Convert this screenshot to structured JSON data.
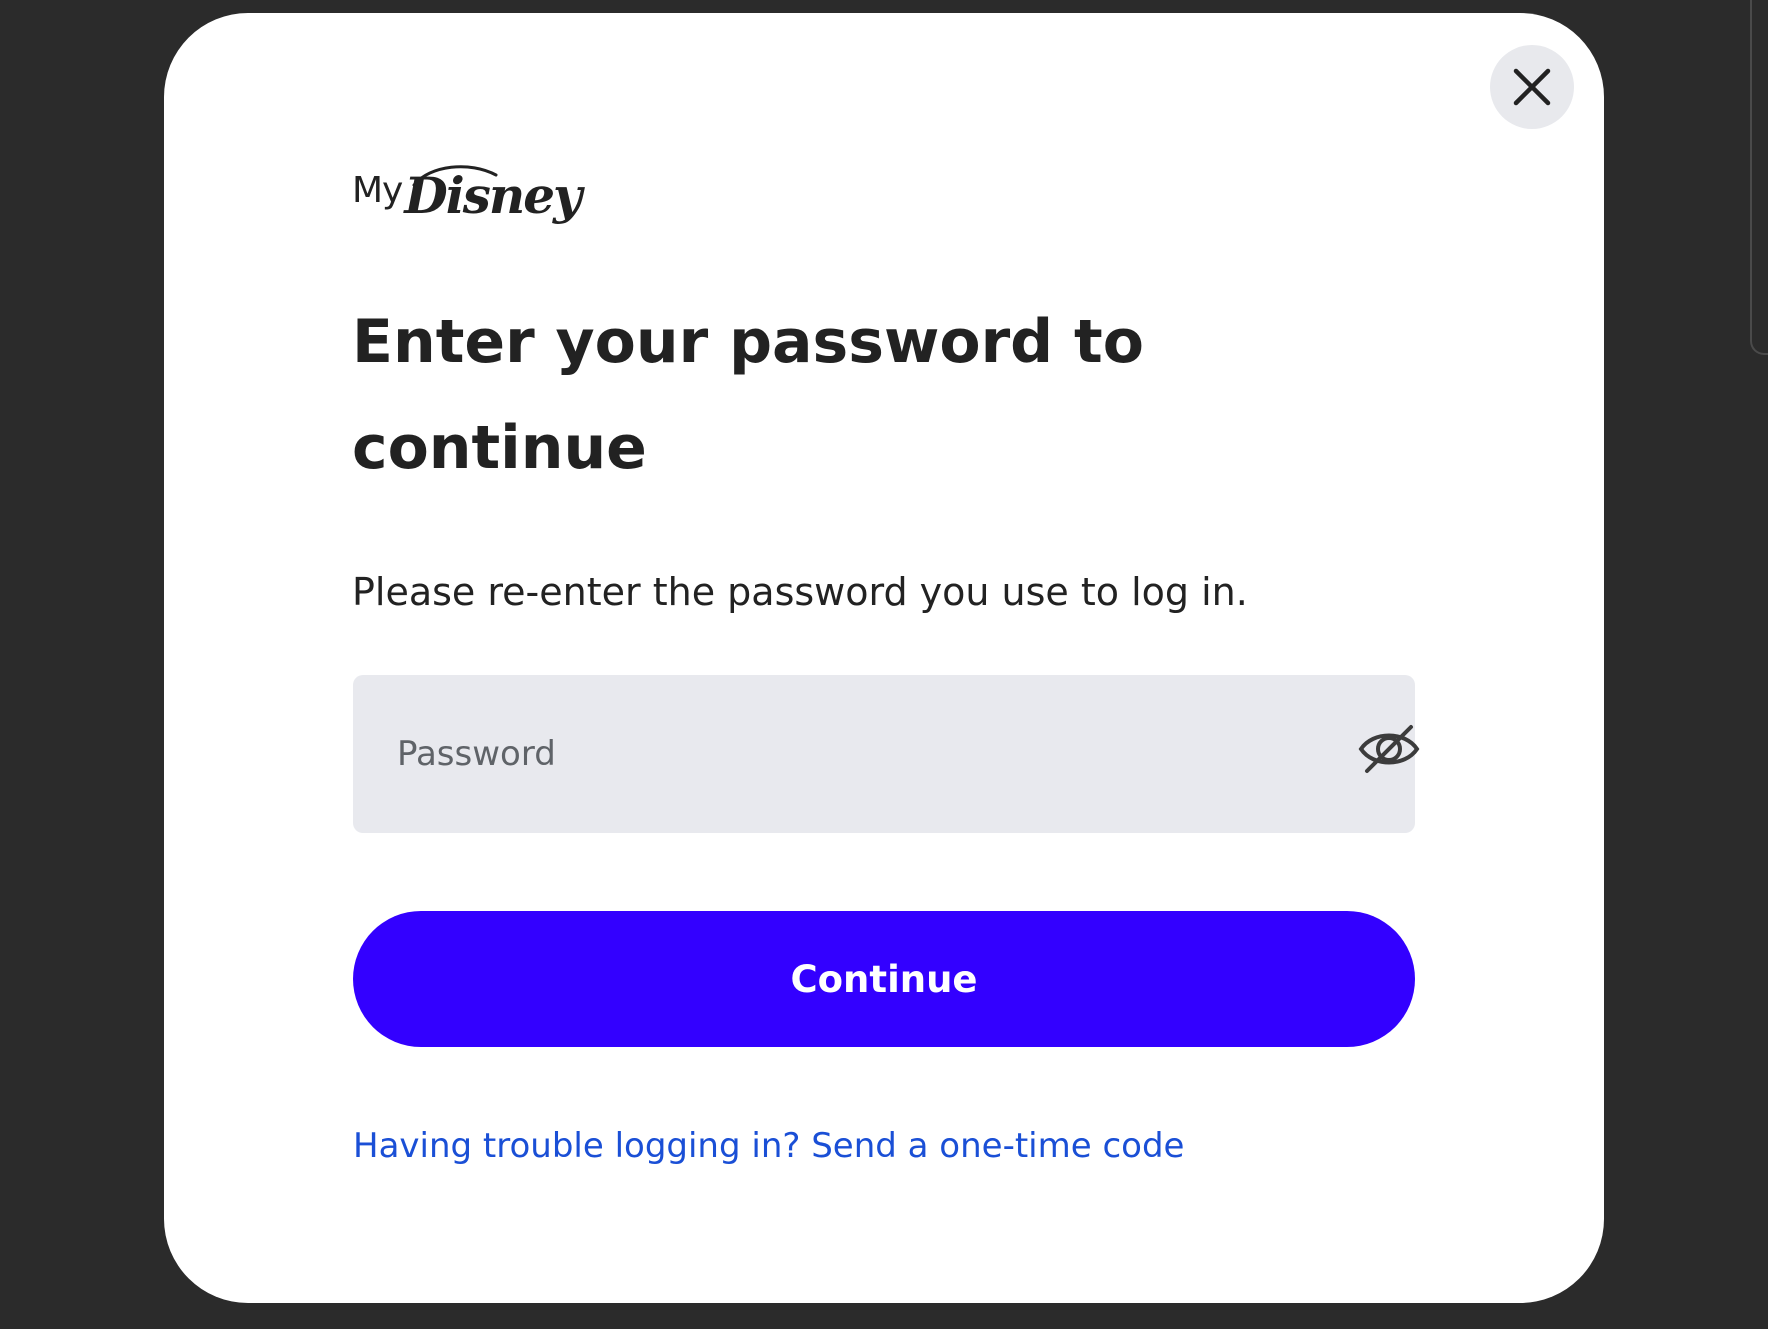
{
  "colors": {
    "backdrop": "#2b2b2b",
    "modal_background": "#ffffff",
    "accent": "#3300ff",
    "link": "#1a4fd6",
    "input_background": "#e8e9ee",
    "text": "#222222"
  },
  "modal": {
    "close_icon": "close-icon",
    "logo": {
      "my": "My",
      "disney": "Disney"
    },
    "title": "Enter your password to continue",
    "subtitle": "Please re-enter the password you use to log in.",
    "password_field": {
      "placeholder": "Password",
      "value": "",
      "toggle_icon": "eye-off-icon"
    },
    "continue_label": "Continue",
    "otp_link": "Having trouble logging in? Send a one-time code"
  }
}
